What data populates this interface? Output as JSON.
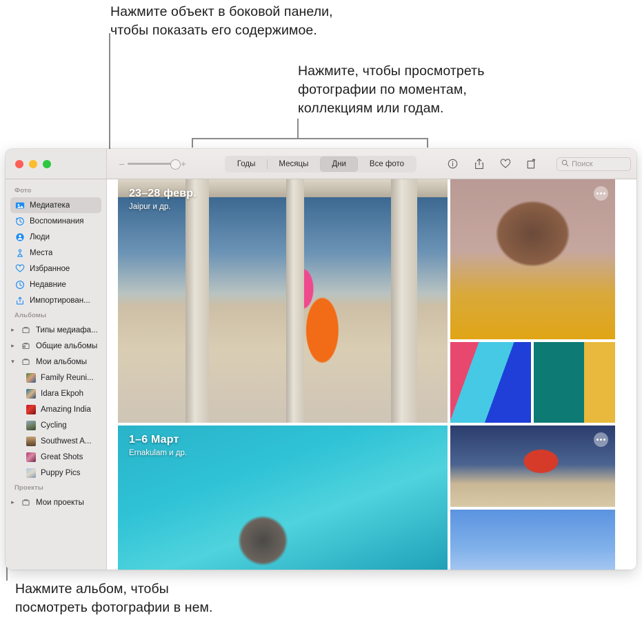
{
  "callouts": {
    "top": "Нажмите объект в боковой панели,\nчтобы показать его содержимое.",
    "middle": "Нажмите, чтобы просмотреть\nфотографии по моментам,\nколлекциям или годам.",
    "bottom": "Нажмите альбом, чтобы\nпосмотреть фотографии в нем."
  },
  "window": {
    "traffic_lights": [
      "close",
      "minimize",
      "zoom"
    ],
    "toolbar": {
      "zoom_slider": {
        "minus": "–",
        "plus": "+",
        "value": 100
      },
      "segments": [
        {
          "label": "Годы",
          "active": false
        },
        {
          "label": "Месяцы",
          "active": false
        },
        {
          "label": "Дни",
          "active": true
        },
        {
          "label": "Все фото",
          "active": false
        }
      ],
      "icons": [
        {
          "name": "info-icon",
          "title": "Информация"
        },
        {
          "name": "share-icon",
          "title": "Поделиться"
        },
        {
          "name": "heart-icon",
          "title": "Избранное"
        },
        {
          "name": "rotate-icon",
          "title": "Повернуть"
        }
      ],
      "search": {
        "placeholder": "Поиск",
        "value": "",
        "icon": "search-icon"
      }
    }
  },
  "sidebar": {
    "sections": [
      {
        "title": "Фото",
        "items": [
          {
            "label": "Медиатека",
            "icon": "photos-library-icon",
            "selected": true
          },
          {
            "label": "Воспоминания",
            "icon": "memories-icon",
            "selected": false
          },
          {
            "label": "Люди",
            "icon": "people-icon",
            "selected": false
          },
          {
            "label": "Места",
            "icon": "places-icon",
            "selected": false
          },
          {
            "label": "Избранное",
            "icon": "heart-icon",
            "selected": false
          },
          {
            "label": "Недавние",
            "icon": "clock-icon",
            "selected": false
          },
          {
            "label": "Импортирован...",
            "icon": "import-icon",
            "selected": false
          }
        ]
      },
      {
        "title": "Альбомы",
        "items": [
          {
            "label": "Типы медиафа...",
            "icon": "folder-icon",
            "chevron": "collapsed"
          },
          {
            "label": "Общие альбомы",
            "icon": "shared-folder-icon",
            "chevron": "collapsed"
          },
          {
            "label": "Мои альбомы",
            "icon": "folder-icon",
            "chevron": "expanded"
          },
          {
            "label": "Family Reuni...",
            "icon": "album-thumb",
            "thumb": "tg1"
          },
          {
            "label": "Idara Ekpoh",
            "icon": "album-thumb",
            "thumb": "tg2"
          },
          {
            "label": "Amazing India",
            "icon": "album-thumb",
            "thumb": "tg3"
          },
          {
            "label": "Cycling",
            "icon": "album-thumb",
            "thumb": "tg4"
          },
          {
            "label": "Southwest A...",
            "icon": "album-thumb",
            "thumb": "tg5"
          },
          {
            "label": "Great Shots",
            "icon": "album-thumb",
            "thumb": "tg6"
          },
          {
            "label": "Puppy Pics",
            "icon": "album-thumb",
            "thumb": "tg7"
          }
        ]
      },
      {
        "title": "Проекты",
        "items": [
          {
            "label": "Мои проекты",
            "icon": "folder-icon",
            "chevron": "collapsed"
          }
        ]
      }
    ]
  },
  "grid": {
    "bands": [
      {
        "date": "23–28 февр.",
        "place": "Jaipur и др.",
        "more_button": true,
        "tiles": [
          "dancer",
          "woman",
          "glasses",
          "door"
        ]
      },
      {
        "date": "1–6 Март",
        "place": "Ernakulam и др.",
        "more_button": true,
        "tiles": [
          "swimmer",
          "biker",
          "sky"
        ]
      }
    ]
  },
  "colors": {
    "accent": "#1b8cf5",
    "sidebar_bg": "#e9e7e6",
    "titlebar_bg": "#e9e5e4",
    "selection": "#d5d2d1",
    "callout_line": "#8a8a8a",
    "text": "#1d1d1f"
  }
}
